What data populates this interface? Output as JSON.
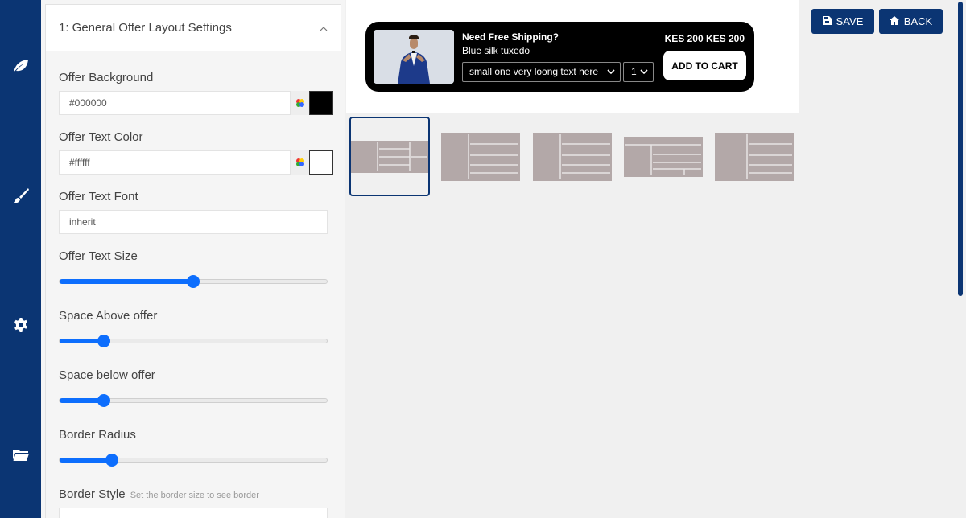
{
  "sidebar": {
    "icons": [
      "leaf-icon",
      "brush-icon",
      "gear-icon",
      "folder-icon"
    ]
  },
  "panel": {
    "title": "1: General Offer Layout Settings",
    "offer_background": {
      "label": "Offer Background",
      "value": "#000000",
      "swatch": "#000000"
    },
    "offer_text_color": {
      "label": "Offer Text Color",
      "value": "#ffffff",
      "swatch": "#ffffff"
    },
    "offer_text_font": {
      "label": "Offer Text Font",
      "value": "inherit"
    },
    "offer_text_size": {
      "label": "Offer Text Size",
      "level": 0.5
    },
    "space_above": {
      "label": "Space Above offer",
      "level": 0.165
    },
    "space_below": {
      "label": "Space below offer",
      "level": 0.165
    },
    "border_radius": {
      "label": "Border Radius",
      "level": 0.195
    },
    "border_style": {
      "label": "Border Style",
      "hint": "Set the border size to see border"
    }
  },
  "preview": {
    "headline": "Need Free Shipping?",
    "product_name": "Blue silk tuxedo",
    "variant": "small one very loong text here",
    "quantity": "1",
    "price": "KES 200",
    "compare_price": "KES 200",
    "cart_label": "ADD TO CART"
  },
  "toolbar": {
    "save_label": "SAVE",
    "back_label": "BACK"
  },
  "colors": {
    "brand": "#0b3573",
    "accent": "#0d6efd",
    "thumb": "#b3a8a8"
  }
}
